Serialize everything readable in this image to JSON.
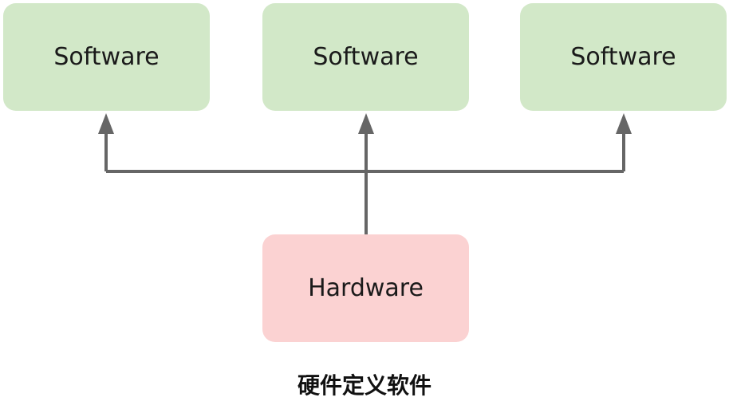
{
  "nodes": {
    "software": [
      "Software",
      "Software",
      "Software"
    ],
    "hardware": "Hardware"
  },
  "caption": "硬件定义软件",
  "colors": {
    "software_fill": "#d2e8c8",
    "hardware_fill": "#fbd2d2",
    "connector": "#666666"
  }
}
